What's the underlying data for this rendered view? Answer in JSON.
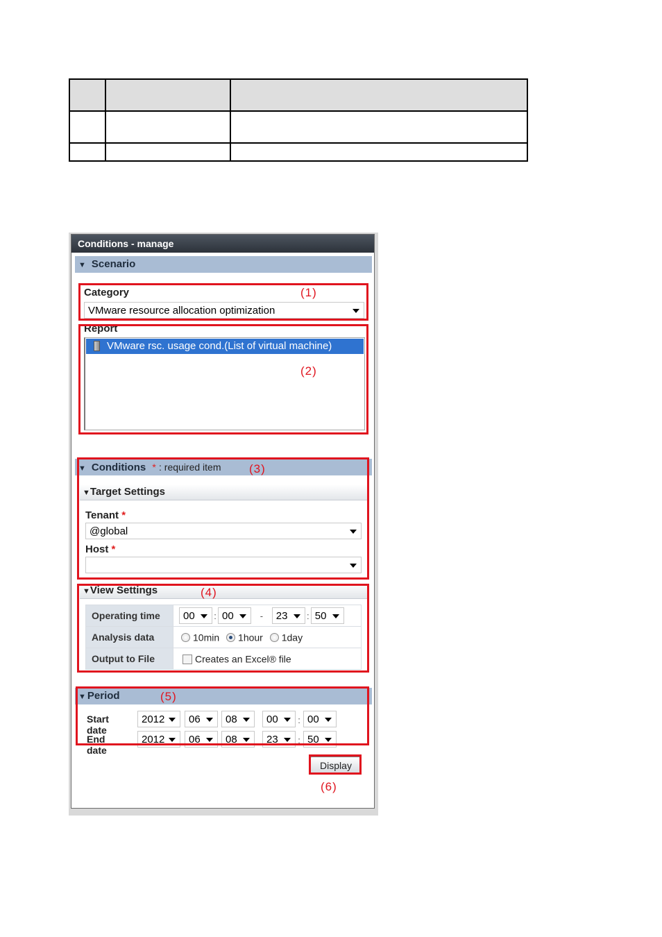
{
  "doc_table": {
    "rows": [
      [
        "",
        "",
        ""
      ],
      [
        "",
        "",
        ""
      ],
      [
        "",
        "",
        ""
      ]
    ]
  },
  "panel": {
    "title": "Conditions - manage",
    "scenario": {
      "header": "Scenario",
      "category_label": "Category",
      "category_value": "VMware resource allocation optimization",
      "report_label": "Report",
      "report_items": [
        "VMware rsc. usage cond.(List of virtual machine)"
      ]
    },
    "conditions": {
      "header": "Conditions",
      "required_note": ": required item",
      "required_mark": "*",
      "target_settings": {
        "header": "Target Settings",
        "tenant_label": "Tenant",
        "tenant_value": "@global",
        "host_label": "Host",
        "host_value": ""
      },
      "view_settings": {
        "header": "View Settings",
        "operating_time_label": "Operating time",
        "operating_time": {
          "start_hour": "00",
          "start_min": "00",
          "range_sep": "-",
          "end_hour": "23",
          "end_min": "50",
          "time_sep": ":"
        },
        "analysis_data_label": "Analysis data",
        "analysis_options": [
          "10min",
          "1hour",
          "1day"
        ],
        "analysis_selected": "1hour",
        "output_label": "Output to File",
        "output_option": "Creates an Excel® file",
        "output_checked": false
      }
    },
    "period": {
      "header": "Period",
      "start_label": "Start date",
      "end_label": "End date",
      "start": {
        "year": "2012",
        "month": "06",
        "day": "08",
        "hour": "00",
        "min": "00"
      },
      "end": {
        "year": "2012",
        "month": "06",
        "day": "08",
        "hour": "23",
        "min": "50"
      },
      "time_sep": ":"
    },
    "display_button": "Display"
  },
  "callouts": [
    "(1)",
    "(2)",
    "(3)",
    "(4)",
    "(5)",
    "(6)"
  ],
  "colors": {
    "highlight": "#e0141e",
    "section_header": "#a9bcd4",
    "selection": "#2f73d0"
  }
}
